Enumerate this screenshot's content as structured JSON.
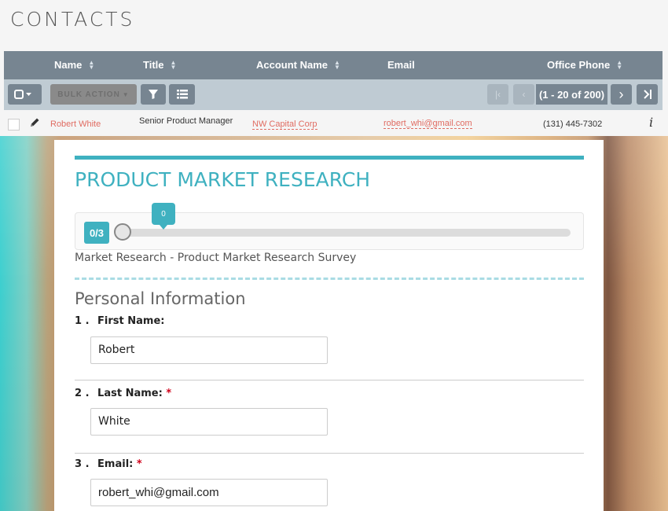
{
  "page": {
    "title": "CONTACTS"
  },
  "list": {
    "columns": [
      {
        "label": "Name",
        "sortable": true
      },
      {
        "label": "Title",
        "sortable": true
      },
      {
        "label": "Account Name",
        "sortable": true
      },
      {
        "label": "Email",
        "sortable": false
      },
      {
        "label": "Office Phone",
        "sortable": true
      }
    ],
    "toolbar": {
      "bulk_action_label": "BULK ACTION",
      "pagination_text": "(1 - 20 of 200)"
    },
    "rows": [
      {
        "name": "Robert White",
        "title": "Senior Product Manager",
        "account": "NW Capital Corp",
        "email": "robert_whi@gmail.com",
        "phone": "(131) 445-7302",
        "info": "i"
      }
    ]
  },
  "survey": {
    "title": "PRODUCT MARKET RESEARCH",
    "progress": {
      "count_label": "0/3",
      "tooltip_value": "0",
      "fraction": 0
    },
    "subtitle": "Market Research - Product Market Research Survey",
    "section_title": "Personal Information",
    "questions": [
      {
        "number": "1 .",
        "label": "First Name:",
        "required": false,
        "value": "Robert"
      },
      {
        "number": "2 .",
        "label": "Last Name:",
        "required": true,
        "value": "White"
      },
      {
        "number": "3 .",
        "label": "Email:",
        "required": true,
        "value": "robert_whi@gmail.com"
      }
    ],
    "required_marker": "*"
  },
  "colors": {
    "accent": "#3fb1c0",
    "header_bg": "#778591",
    "toolbar_bg": "#bfcbd3",
    "link_red": "#e06c62",
    "required_red": "#d0021b"
  },
  "icons": [
    "select-all-dropdown-icon",
    "filter-icon",
    "column-chooser-icon",
    "first-page-icon",
    "prev-page-icon",
    "next-page-icon",
    "last-page-icon",
    "edit-pencil-icon",
    "info-icon",
    "sort-icon"
  ]
}
